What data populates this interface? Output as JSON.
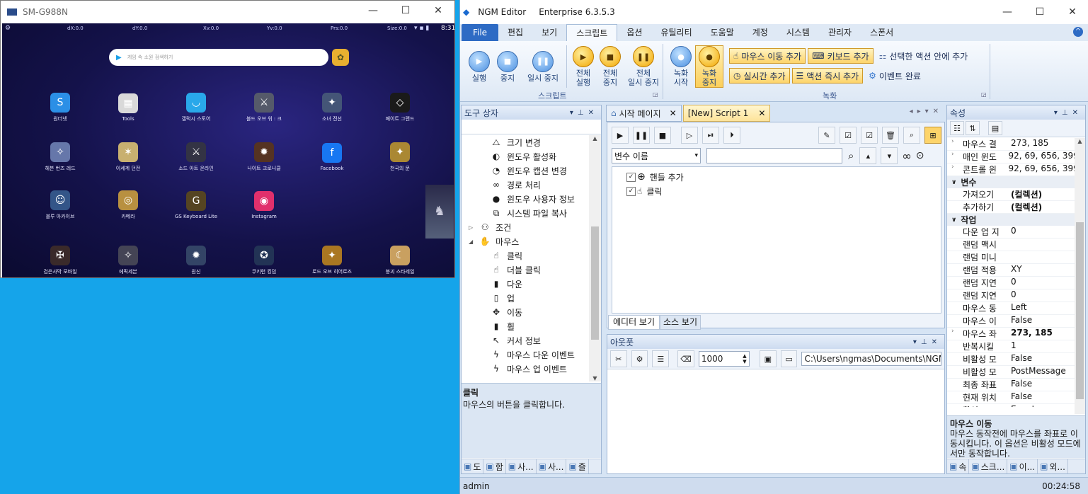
{
  "phone": {
    "title": "SM-G988N",
    "status": {
      "left": "dX:0.0",
      "c1": "dY:0.0",
      "c2": "Xv:0.0",
      "c3": "Yv:0.0",
      "c4": "Prs:0.0",
      "c5": "Size:0.0",
      "time": "8:31"
    },
    "search_placeholder": "게임 속 소원 검색하기",
    "apps_row1": [
      {
        "label": "원더넷",
        "color": "#2b8fe6",
        "icon": "S"
      },
      {
        "label": "Tools",
        "color": "#d9d9d9",
        "icon": "▦"
      },
      {
        "label": "갤럭시 스토어",
        "color": "#29a8ea",
        "icon": "◡"
      },
      {
        "label": "블드 오브 워 : 크",
        "color": "#555a6a",
        "icon": "⚔"
      },
      {
        "label": "소녀 전선",
        "color": "#445577",
        "icon": "✦"
      },
      {
        "label": "페이트 그랜드",
        "color": "#1a1a1a",
        "icon": "◇"
      }
    ],
    "apps_row2": [
      {
        "label": "헤븐 번즈 레드",
        "color": "#6677aa",
        "icon": "✧"
      },
      {
        "label": "이세계 던전",
        "color": "#c8b070",
        "icon": "✶"
      },
      {
        "label": "소드 아트 온라인",
        "color": "#333344",
        "icon": "⚔"
      },
      {
        "label": "나이트 크로니클",
        "color": "#553322",
        "icon": "✹"
      },
      {
        "label": "Facebook",
        "color": "#1877f2",
        "icon": "f"
      },
      {
        "label": "천국의 문",
        "color": "#aa8833",
        "icon": "✦"
      }
    ],
    "apps_row3": [
      {
        "label": "블루 아카이브",
        "color": "#335588",
        "icon": "☺"
      },
      {
        "label": "카메라",
        "color": "#b89040",
        "icon": "◎"
      },
      {
        "label": "GS Keyboard Lite",
        "color": "#554422",
        "icon": "G"
      },
      {
        "label": "Instagram",
        "color": "#e1306c",
        "icon": "◉"
      }
    ],
    "dock": [
      {
        "label": "검은사막 모바일",
        "color": "#3a2a2a",
        "icon": "✠"
      },
      {
        "label": "에픽세븐",
        "color": "#444455",
        "icon": "✧"
      },
      {
        "label": "원신",
        "color": "#334466",
        "icon": "✹"
      },
      {
        "label": "쿠키런 킹덤",
        "color": "#223355",
        "icon": "✪"
      },
      {
        "label": "로드 오브 히어로즈",
        "color": "#aa7722",
        "icon": "✦"
      },
      {
        "label": "붕괴 스타레일",
        "color": "#c9a060",
        "icon": "☾"
      }
    ]
  },
  "ngm": {
    "title": "NGM Editor",
    "edition": "Enterprise 6.3.5.3",
    "menus": [
      "File",
      "편집",
      "보기",
      "스크립트",
      "옵션",
      "유틸리티",
      "도움말",
      "계정",
      "시스템",
      "관리자",
      "스폰서"
    ],
    "active_menu": "스크립트",
    "ribbon": {
      "play": "실행",
      "stop": "중지",
      "pause": "일시 중지",
      "play_all_1": "전체",
      "play_all_2": "실행",
      "stop_all_1": "전체",
      "stop_all_2": "중지",
      "pause_all_1": "전체",
      "pause_all_2": "일시 중지",
      "script_group": "스크립트",
      "rec_start_1": "녹화",
      "rec_start_2": "시작",
      "rec_stop_1": "녹화",
      "rec_stop_2": "중지",
      "mouse_move_add": "마우스 이동 추가",
      "keyboard_add": "키보드 추가",
      "selected_action_add": "선택한 액션 안에 추가",
      "realtime_add": "실시간 추가",
      "action_immediate_add": "액션 즉시 추가",
      "event_complete": "이벤트 완료",
      "record_group": "녹화"
    },
    "toolbox": {
      "title": "도구 상자",
      "items": [
        {
          "icon": "⧍",
          "label": "크기 변경",
          "indent": 1
        },
        {
          "icon": "◐",
          "label": "윈도우 활성화",
          "indent": 1
        },
        {
          "icon": "◔",
          "label": "윈도우 캡션 변경",
          "indent": 1
        },
        {
          "icon": "∞",
          "label": "경로 처리",
          "indent": 1
        },
        {
          "icon": "●",
          "label": "윈도우 사용자 정보",
          "indent": 1
        },
        {
          "icon": "⧉",
          "label": "시스템 파일 복사",
          "indent": 1
        },
        {
          "icon": "⚇",
          "label": "조건",
          "indent": 0,
          "exp": "▷"
        },
        {
          "icon": "✋",
          "label": "마우스",
          "indent": 0,
          "exp": "◢"
        },
        {
          "icon": "☝",
          "label": "클릭",
          "indent": 1
        },
        {
          "icon": "☝",
          "label": "더블 클릭",
          "indent": 1
        },
        {
          "icon": "▮",
          "label": "다운",
          "indent": 1
        },
        {
          "icon": "▯",
          "label": "업",
          "indent": 1
        },
        {
          "icon": "✥",
          "label": "이동",
          "indent": 1
        },
        {
          "icon": "▮",
          "label": "휠",
          "indent": 1
        },
        {
          "icon": "↖",
          "label": "커서 정보",
          "indent": 1
        },
        {
          "icon": "ϟ",
          "label": "마우스 다운 이벤트",
          "indent": 1
        },
        {
          "icon": "ϟ",
          "label": "마우스 업 이벤트",
          "indent": 1
        }
      ],
      "desc_title": "클릭",
      "desc_text": "마우스의 버튼을 클릭합니다.",
      "bottom_tabs": [
        "도",
        "함",
        "사...",
        "사...",
        "즐"
      ]
    },
    "doc_tabs": [
      "시작 페이지",
      "[New] Script 1"
    ],
    "script": {
      "var_select": "변수 이름",
      "nodes": [
        "핸들 추가",
        "클릭"
      ],
      "view_tabs": [
        "에디터 보기",
        "소스 보기"
      ]
    },
    "output": {
      "title": "아웃풋",
      "count": "1000",
      "path": "C:\\Users\\ngmas\\Documents\\NGM6\\"
    },
    "properties": {
      "title": "속성",
      "rows_top": [
        {
          "k": "마우스 결",
          "v": "273, 185",
          "exp": true
        },
        {
          "k": "매인 윈도",
          "v": "92, 69, 656, 399",
          "exp": true
        },
        {
          "k": "콘트롤 윈",
          "v": "92, 69, 656, 399",
          "exp": true
        }
      ],
      "cat_var": "변수",
      "rows_var": [
        {
          "k": "가져오기",
          "v": "(컬렉션)",
          "bold": true
        },
        {
          "k": "추가하기",
          "v": "(컬렉션)",
          "bold": true
        }
      ],
      "cat_work": "작업",
      "rows_work": [
        {
          "k": "다운 업 지",
          "v": "0"
        },
        {
          "k": "랜덤 맥시",
          "v": ""
        },
        {
          "k": "랜덤 미니",
          "v": ""
        },
        {
          "k": "랜덤 적용",
          "v": "XY"
        },
        {
          "k": "랜덤 지연",
          "v": "0"
        },
        {
          "k": "랜덤 지연",
          "v": "0"
        },
        {
          "k": "마우스 동",
          "v": "Left"
        },
        {
          "k": "마우스 이",
          "v": "False"
        },
        {
          "k": "마우스 좌",
          "v": "273, 185",
          "bold": true,
          "exp": true
        },
        {
          "k": "반복시킬",
          "v": "1"
        },
        {
          "k": "비활성 모",
          "v": "False"
        },
        {
          "k": "비활성 모",
          "v": "PostMessage"
        },
        {
          "k": "최종 좌표",
          "v": "False"
        },
        {
          "k": "현재 위치",
          "v": "False"
        },
        {
          "k": "활성 모드",
          "v": "Event"
        }
      ],
      "desc_title": "마우스 이동",
      "desc_text": "마우스 동작전에 마우스를 좌표로 이동시킵니다. 이 옵션은 비활성 모드에서만 동작합니다.",
      "bottom_tabs": [
        "속",
        "스크...",
        "이...",
        "외..."
      ]
    },
    "status": {
      "user": "admin",
      "time": "00:24:58"
    }
  }
}
